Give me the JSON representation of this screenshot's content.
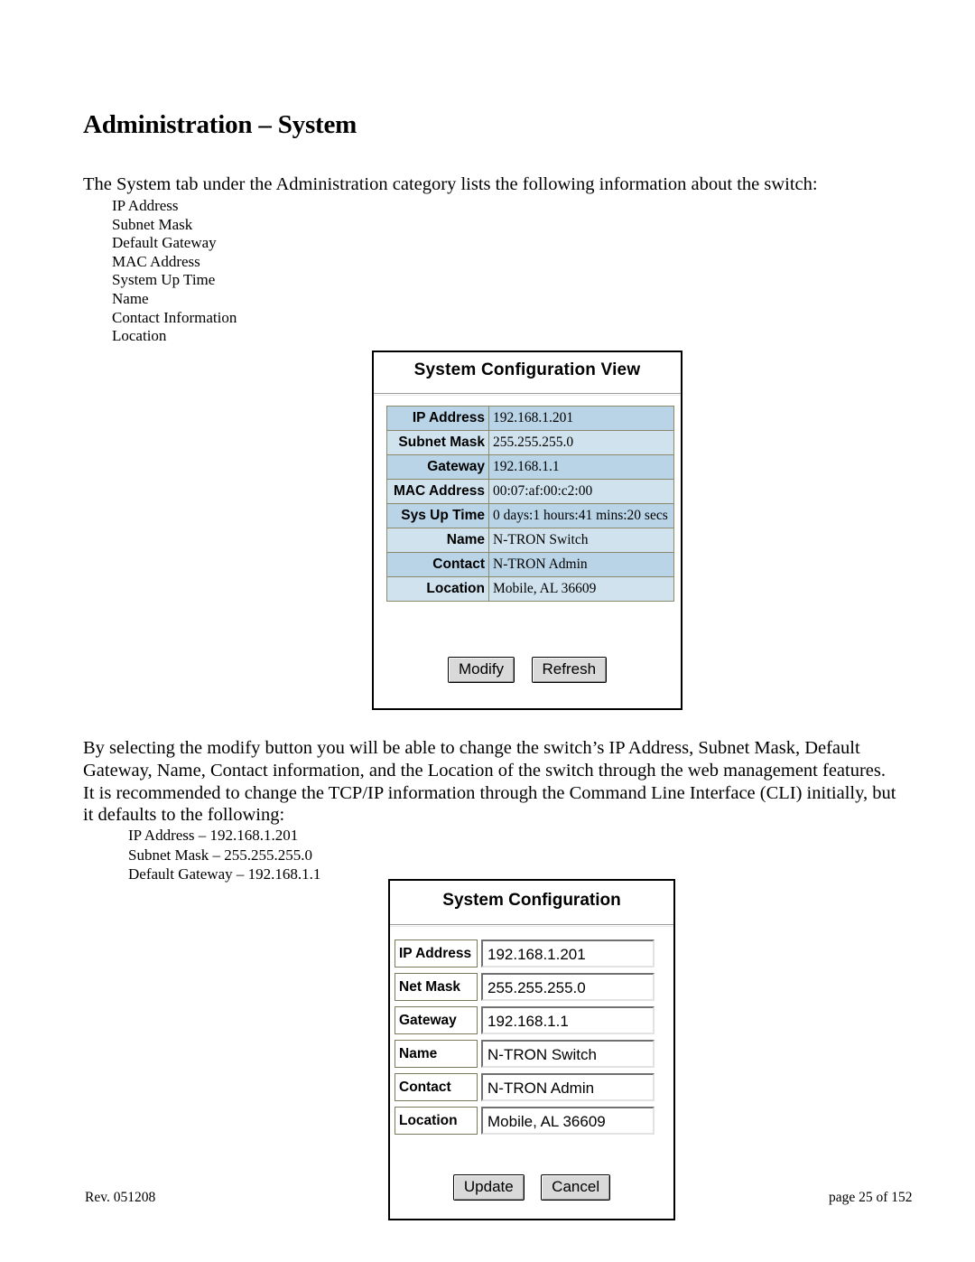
{
  "document": {
    "heading": "Administration – System",
    "intro": "The System tab under the Administration category lists the following information about the switch:",
    "bullets": [
      "IP Address",
      "Subnet Mask",
      "Default Gateway",
      "MAC Address",
      "System Up Time",
      "Name",
      "Contact Information",
      "Location"
    ],
    "paragraph2": "By selecting the modify button you will be able to change the switch’s IP Address, Subnet Mask, Default Gateway, Name, Contact information, and the Location of the switch through the web management features. It is recommended to change the TCP/IP information through the Command Line Interface (CLI) initially, but it defaults to the following:",
    "defaults": [
      "IP Address – 192.168.1.201",
      "Subnet Mask – 255.255.255.0",
      "Default Gateway – 192.168.1.1"
    ],
    "footer_left": "Rev.  051208",
    "footer_right": "page 25 of 152"
  },
  "view_panel": {
    "title": "System Configuration View",
    "rows": [
      {
        "label": "IP Address",
        "value": "192.168.1.201"
      },
      {
        "label": "Subnet Mask",
        "value": "255.255.255.0"
      },
      {
        "label": "Gateway",
        "value": "192.168.1.1"
      },
      {
        "label": "MAC Address",
        "value": "00:07:af:00:c2:00"
      },
      {
        "label": "Sys Up Time",
        "value": "0 days:1 hours:41 mins:20 secs"
      },
      {
        "label": "Name",
        "value": "N-TRON Switch"
      },
      {
        "label": "Contact",
        "value": "N-TRON Admin"
      },
      {
        "label": "Location",
        "value": "Mobile, AL 36609"
      }
    ],
    "modify_label": "Modify",
    "refresh_label": "Refresh"
  },
  "edit_panel": {
    "title": "System Configuration",
    "fields": [
      {
        "label": "IP Address",
        "value": "192.168.1.201"
      },
      {
        "label": "Net Mask",
        "value": "255.255.255.0"
      },
      {
        "label": "Gateway",
        "value": "192.168.1.1"
      },
      {
        "label": "Name",
        "value": "N-TRON Switch"
      },
      {
        "label": "Contact",
        "value": "N-TRON Admin"
      },
      {
        "label": "Location",
        "value": "Mobile, AL 36609"
      }
    ],
    "update_label": "Update",
    "cancel_label": "Cancel"
  },
  "colors": {
    "table_row": "#b9d4e6",
    "table_row_alt": "#cfe2ee",
    "button_face": "#d9d9d9"
  }
}
